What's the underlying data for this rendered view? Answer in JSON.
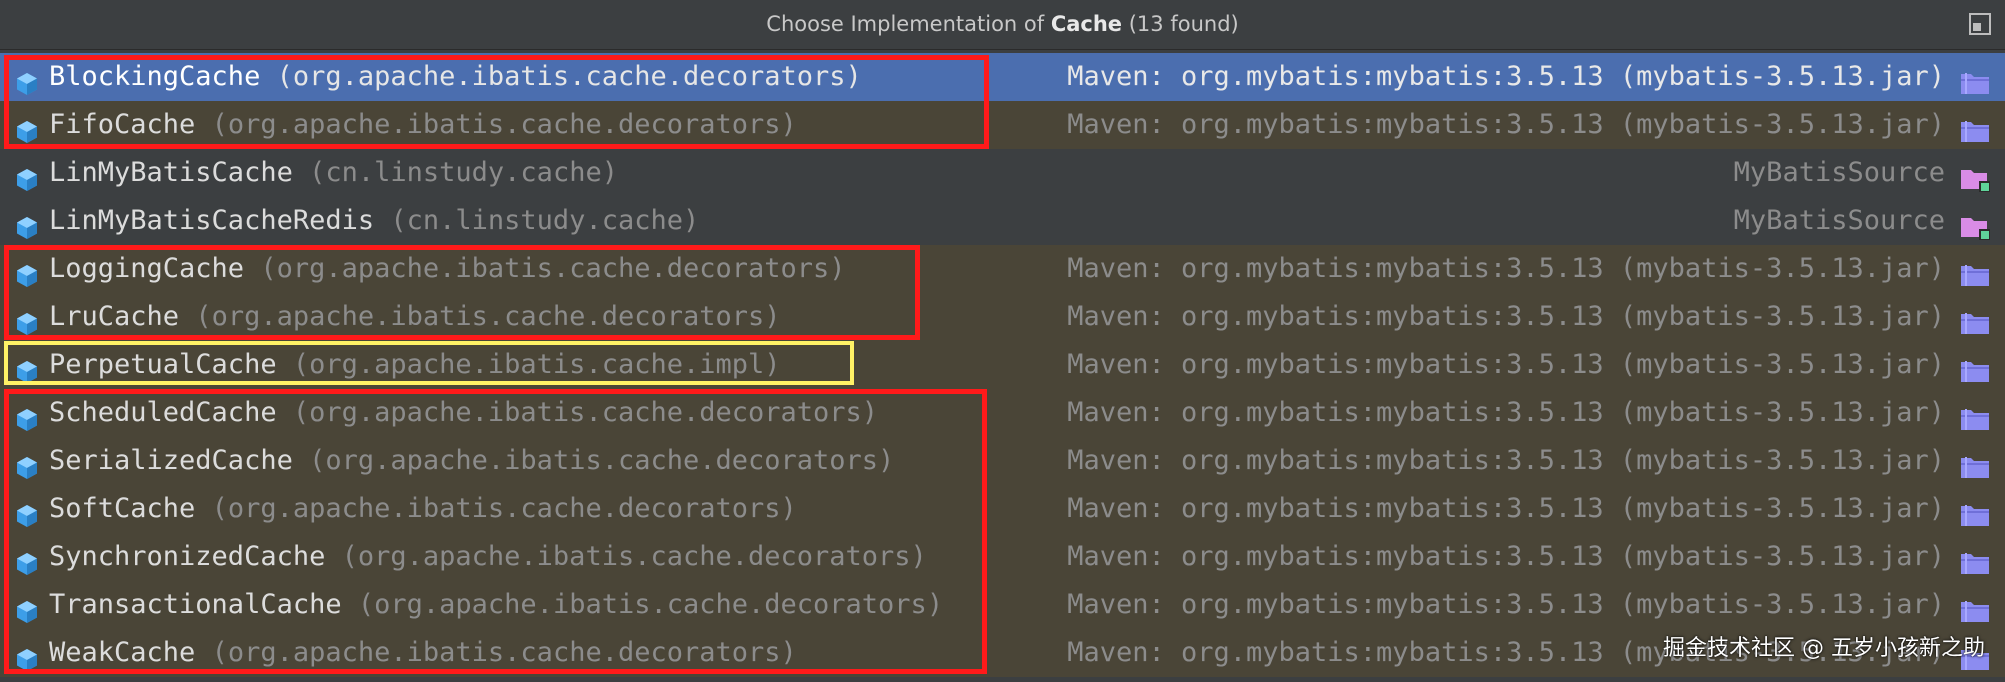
{
  "header": {
    "prefix": "Choose Implementation of ",
    "subject": "Cache",
    "count": " (13 found)",
    "pin_icon": "pin-window-icon"
  },
  "items": [
    {
      "name": "BlockingCache",
      "pkg": "(org.apache.ibatis.cache.decorators)",
      "location": "Maven: org.mybatis:mybatis:3.5.13 (mybatis-3.5.13.jar)",
      "kind": "lib",
      "selected": true
    },
    {
      "name": "FifoCache",
      "pkg": "(org.apache.ibatis.cache.decorators)",
      "location": "Maven: org.mybatis:mybatis:3.5.13 (mybatis-3.5.13.jar)",
      "kind": "lib",
      "selected": false
    },
    {
      "name": "LinMyBatisCache",
      "pkg": "(cn.linstudy.cache)",
      "location": "MyBatisSource",
      "kind": "src",
      "selected": false
    },
    {
      "name": "LinMyBatisCacheRedis",
      "pkg": "(cn.linstudy.cache)",
      "location": "MyBatisSource",
      "kind": "src",
      "selected": false
    },
    {
      "name": "LoggingCache",
      "pkg": "(org.apache.ibatis.cache.decorators)",
      "location": "Maven: org.mybatis:mybatis:3.5.13 (mybatis-3.5.13.jar)",
      "kind": "lib",
      "selected": false
    },
    {
      "name": "LruCache",
      "pkg": "(org.apache.ibatis.cache.decorators)",
      "location": "Maven: org.mybatis:mybatis:3.5.13 (mybatis-3.5.13.jar)",
      "kind": "lib",
      "selected": false
    },
    {
      "name": "PerpetualCache",
      "pkg": "(org.apache.ibatis.cache.impl)",
      "location": "Maven: org.mybatis:mybatis:3.5.13 (mybatis-3.5.13.jar)",
      "kind": "lib",
      "selected": false
    },
    {
      "name": "ScheduledCache",
      "pkg": "(org.apache.ibatis.cache.decorators)",
      "location": "Maven: org.mybatis:mybatis:3.5.13 (mybatis-3.5.13.jar)",
      "kind": "lib",
      "selected": false
    },
    {
      "name": "SerializedCache",
      "pkg": "(org.apache.ibatis.cache.decorators)",
      "location": "Maven: org.mybatis:mybatis:3.5.13 (mybatis-3.5.13.jar)",
      "kind": "lib",
      "selected": false
    },
    {
      "name": "SoftCache",
      "pkg": "(org.apache.ibatis.cache.decorators)",
      "location": "Maven: org.mybatis:mybatis:3.5.13 (mybatis-3.5.13.jar)",
      "kind": "lib",
      "selected": false
    },
    {
      "name": "SynchronizedCache",
      "pkg": "(org.apache.ibatis.cache.decorators)",
      "location": "Maven: org.mybatis:mybatis:3.5.13 (mybatis-3.5.13.jar)",
      "kind": "lib",
      "selected": false
    },
    {
      "name": "TransactionalCache",
      "pkg": "(org.apache.ibatis.cache.decorators)",
      "location": "Maven: org.mybatis:mybatis:3.5.13 (mybatis-3.5.13.jar)",
      "kind": "lib",
      "selected": false
    },
    {
      "name": "WeakCache",
      "pkg": "(org.apache.ibatis.cache.decorators)",
      "location": "Maven: org.mybatis:mybatis:3.5.13 (mybatis-3.5.13.jar)",
      "kind": "lib",
      "selected": false
    }
  ],
  "icons": {
    "class": "class-cube-icon",
    "library": "library-folder-icon",
    "source": "source-module-folder-icon"
  },
  "colors": {
    "selection": "#4b6eaf",
    "library_row": "#4a4537",
    "highlight_red": "#ff1a1a",
    "highlight_yellow": "#fff266",
    "class_icon": "#3d9ee8",
    "library_folder": "#8c8cf0",
    "source_folder": "#d98ce6"
  },
  "watermark": "掘金技术社区 @ 五岁小孩新之助"
}
